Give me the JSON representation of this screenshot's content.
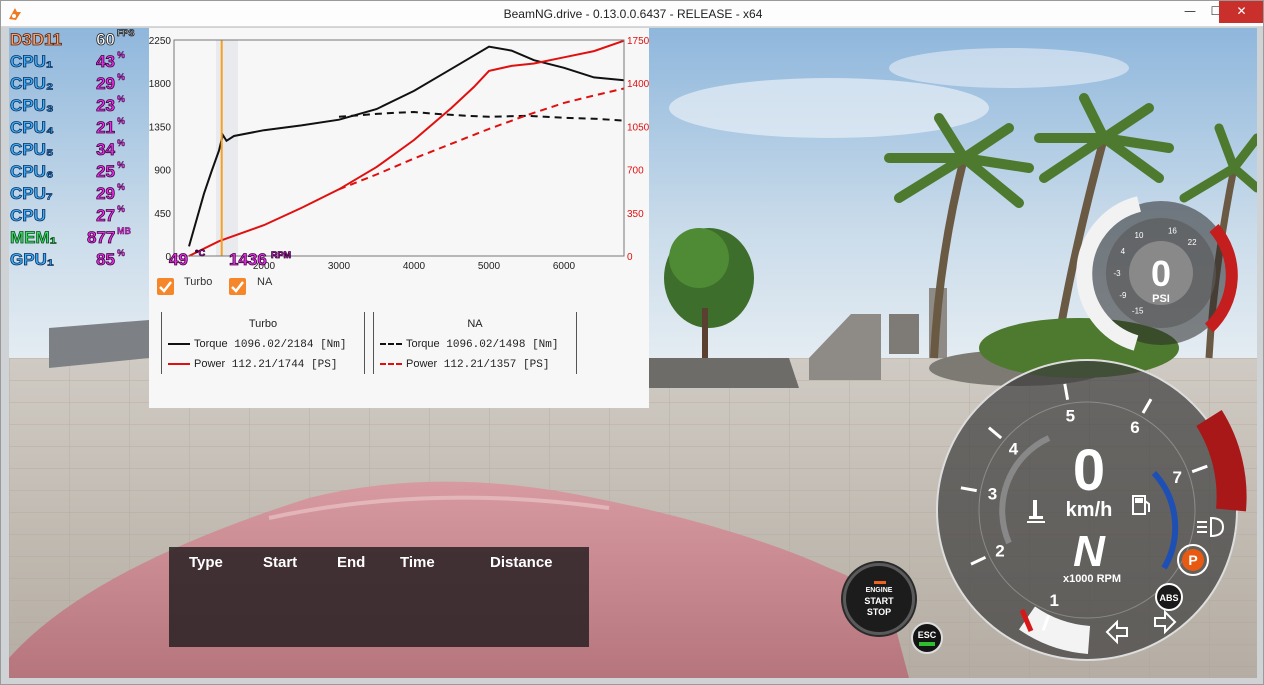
{
  "window": {
    "title": "BeamNG.drive - 0.13.0.0.6437 - RELEASE - x64",
    "minimize": "—",
    "maximize": "☐",
    "close": "✕"
  },
  "perf": [
    {
      "label": "D3D11",
      "value": "60",
      "unit": "FPS",
      "kind": "d3d"
    },
    {
      "label": "CPU₁",
      "value": "43",
      "unit": "%",
      "kind": "cpu"
    },
    {
      "label": "CPU₂",
      "value": "29",
      "unit": "%",
      "kind": "cpu"
    },
    {
      "label": "CPU₃",
      "value": "23",
      "unit": "%",
      "kind": "cpu"
    },
    {
      "label": "CPU₄",
      "value": "21",
      "unit": "%",
      "kind": "cpu"
    },
    {
      "label": "CPU₅",
      "value": "34",
      "unit": "%",
      "kind": "cpu"
    },
    {
      "label": "CPU₆",
      "value": "25",
      "unit": "%",
      "kind": "cpu"
    },
    {
      "label": "CPU₇",
      "value": "29",
      "unit": "%",
      "kind": "cpu"
    },
    {
      "label": "CPU",
      "value": "27",
      "unit": "%",
      "kind": "cpu"
    },
    {
      "label": "MEM₁",
      "value": "877",
      "unit": "MB",
      "kind": "mem"
    },
    {
      "label": "GPU₁",
      "value": "85",
      "unit": "%",
      "kind": "cpu"
    }
  ],
  "dyno": {
    "temp_value": "49",
    "temp_unit": "°C",
    "rpm_value": "1436",
    "rpm_unit": "RPM",
    "checkboxes": [
      {
        "label": "Turbo",
        "checked": true
      },
      {
        "label": "NA",
        "checked": true
      }
    ],
    "legend": {
      "turbo": {
        "title": "Turbo",
        "torque_name": "Torque",
        "torque_value": "1096.02/2184 [Nm]",
        "power_name": "Power",
        "power_value": "112.21/1744  [PS]"
      },
      "na": {
        "title": "NA",
        "torque_name": "Torque",
        "torque_value": "1096.02/1498 [Nm]",
        "power_name": "Power",
        "power_value": "112.21/1357  [PS]"
      }
    },
    "colors": {
      "torque": "#111111",
      "power": "#e01010",
      "marker": "#f5a020",
      "checkbox": "#f5862a"
    }
  },
  "chart_data": {
    "type": "line",
    "title": "",
    "xlabel": "",
    "ylabel": "",
    "xlim": [
      800,
      6800
    ],
    "ylim_left": [
      0,
      2250
    ],
    "ylim_right": [
      0,
      1750
    ],
    "x_ticks": [
      "2000",
      "3000",
      "4000",
      "5000",
      "6000"
    ],
    "y_left_ticks": [
      "0",
      "450",
      "900",
      "1350",
      "1800",
      "2250"
    ],
    "y_right_ticks": [
      "0",
      "350",
      "700",
      "1050",
      "1400",
      "1750"
    ],
    "marker_rpm": 1436,
    "series": [
      {
        "name": "Torque",
        "group": "Turbo",
        "axis": "left",
        "style": "solid",
        "color": "#111111",
        "x": [
          1000,
          1200,
          1300,
          1400,
          1450,
          1500,
          1600,
          2000,
          2500,
          3000,
          3500,
          4000,
          4500,
          5000,
          5300,
          5600,
          6000,
          6400,
          6800
        ],
        "y": [
          100,
          650,
          880,
          1100,
          1260,
          1200,
          1250,
          1310,
          1360,
          1420,
          1530,
          1720,
          1950,
          2180,
          2140,
          2040,
          1960,
          1860,
          1830
        ]
      },
      {
        "name": "Torque",
        "group": "NA",
        "axis": "left",
        "style": "dashed",
        "color": "#111111",
        "x": [
          3000,
          3500,
          3700,
          4000,
          4300,
          4700,
          5000,
          5500,
          6000,
          6400,
          6800
        ],
        "y": [
          1450,
          1480,
          1490,
          1500,
          1480,
          1460,
          1450,
          1460,
          1440,
          1430,
          1410
        ]
      },
      {
        "name": "Power",
        "group": "Turbo",
        "axis": "right",
        "style": "solid",
        "color": "#e01010",
        "x": [
          1000,
          1400,
          2000,
          2500,
          3000,
          3500,
          4000,
          4500,
          4800,
          5000,
          5300,
          5600,
          6000,
          6400,
          6800
        ],
        "y": [
          0,
          120,
          250,
          390,
          540,
          720,
          940,
          1200,
          1370,
          1500,
          1540,
          1560,
          1610,
          1660,
          1744
        ]
      },
      {
        "name": "Power",
        "group": "NA",
        "axis": "right",
        "style": "dashed",
        "color": "#e01010",
        "x": [
          3000,
          3500,
          4000,
          4500,
          5000,
          5500,
          6000,
          6400,
          6800
        ],
        "y": [
          540,
          660,
          790,
          910,
          1030,
          1140,
          1240,
          1300,
          1357
        ]
      }
    ],
    "legend": "bottom",
    "grid": false
  },
  "trips": {
    "columns": [
      "Type",
      "Start",
      "End",
      "Time",
      "Distance"
    ],
    "rows": []
  },
  "boost_gauge": {
    "value": "0",
    "unit": "PSI",
    "ticks": [
      "-15",
      "-9",
      "-3",
      "4",
      "10",
      "16",
      "22"
    ]
  },
  "speedo": {
    "speed": "0",
    "speed_unit": "km/h",
    "gear": "N",
    "rpm_unit": "x1000 RPM",
    "rpm_ticks": [
      "1",
      "2",
      "3",
      "4",
      "5",
      "6",
      "7"
    ],
    "parking_label": "P",
    "abs_label": "ABS"
  },
  "engine_button": {
    "line1": "ENGINE",
    "line2": "START",
    "line3": "STOP"
  },
  "esc_label": "ESC"
}
